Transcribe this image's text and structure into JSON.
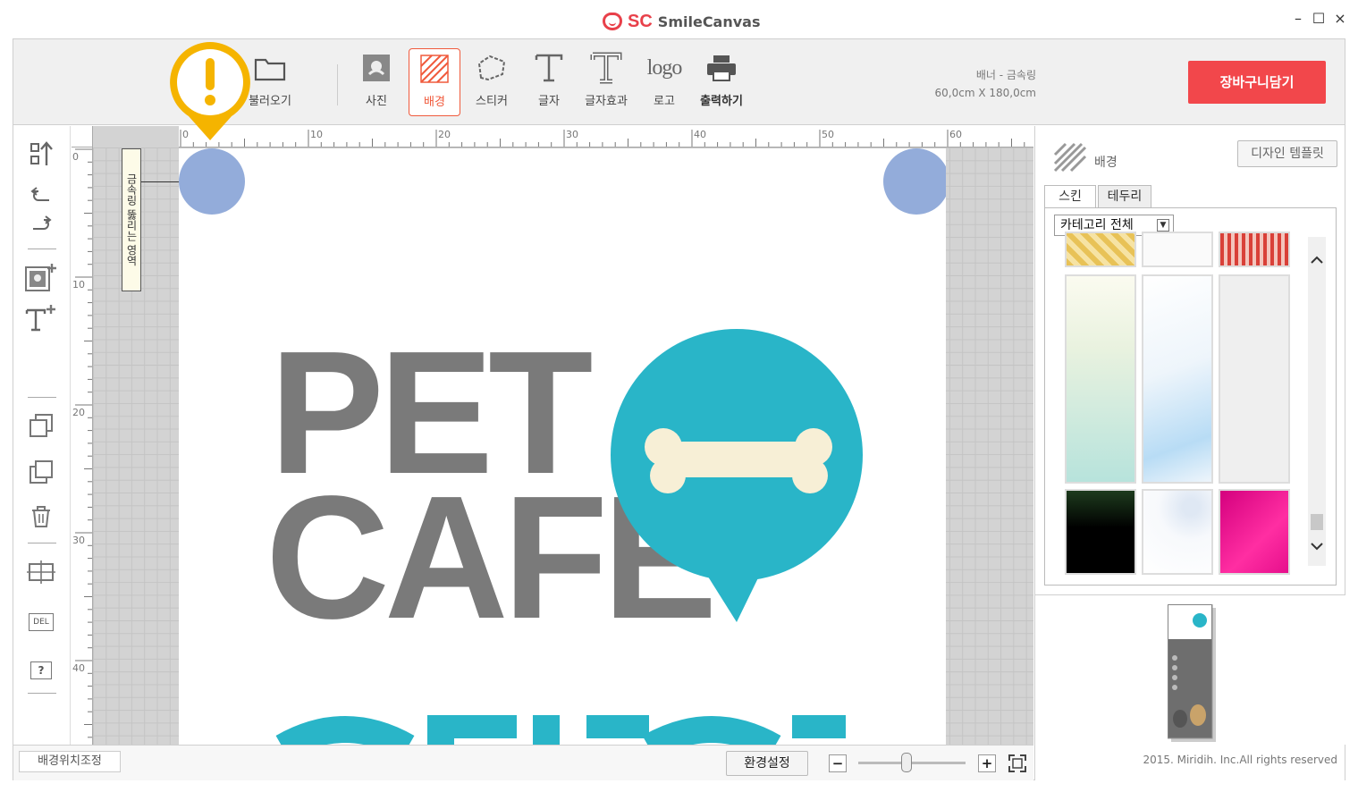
{
  "app": {
    "brand": "SC",
    "name": "SmileCanvas"
  },
  "window": {
    "minimize": "–",
    "maximize": "☐",
    "close": "×"
  },
  "toolbar": {
    "open_label": "불러오기",
    "tools": [
      "사진",
      "배경",
      "스티커",
      "글자",
      "글자효과",
      "로고",
      "출력하기"
    ],
    "active_tool": "배경",
    "product": "배너 - 금속링",
    "dimensions": "60,0cm X 180,0cm",
    "cart_label": "장바구니담기",
    "logo_icon_text": "logo"
  },
  "left_tools": [
    "upload-icon",
    "undo-icon",
    "redo-icon",
    "add-photo-icon",
    "add-text-icon",
    "bring-front-icon",
    "send-back-icon",
    "trash-icon",
    "align-icon",
    "delete-icon",
    "help-icon"
  ],
  "left_tool_texts": {
    "del": "DEL",
    "help": "?"
  },
  "ruler": {
    "h_labels": [
      "0",
      "10",
      "20",
      "30",
      "40",
      "50",
      "60"
    ],
    "v_labels": [
      "0",
      "10",
      "20",
      "30",
      "40"
    ]
  },
  "canvas": {
    "ring_note": "금속링 뚫리는 영역",
    "line1": "PET",
    "line2": "CAFE",
    "accent": "#29b5c8"
  },
  "status": {
    "bg_position_label": "배경위치조정",
    "env_label": "환경설정",
    "zoom_out": "−",
    "zoom_in": "+",
    "zoom_level": 0.45
  },
  "panel": {
    "title": "배경",
    "template_btn": "디자인 템플릿",
    "tabs": [
      "스킨",
      "테두리"
    ],
    "category": "카테고리 전체",
    "copyright": "2015. Miridih. Inc.All rights reserved"
  },
  "colors": {
    "cart": "#f2474b",
    "active_tool": "#f05a3c",
    "warn": "#f5b400",
    "ring": "#93acda",
    "pet_text": "#7a7a7a"
  }
}
